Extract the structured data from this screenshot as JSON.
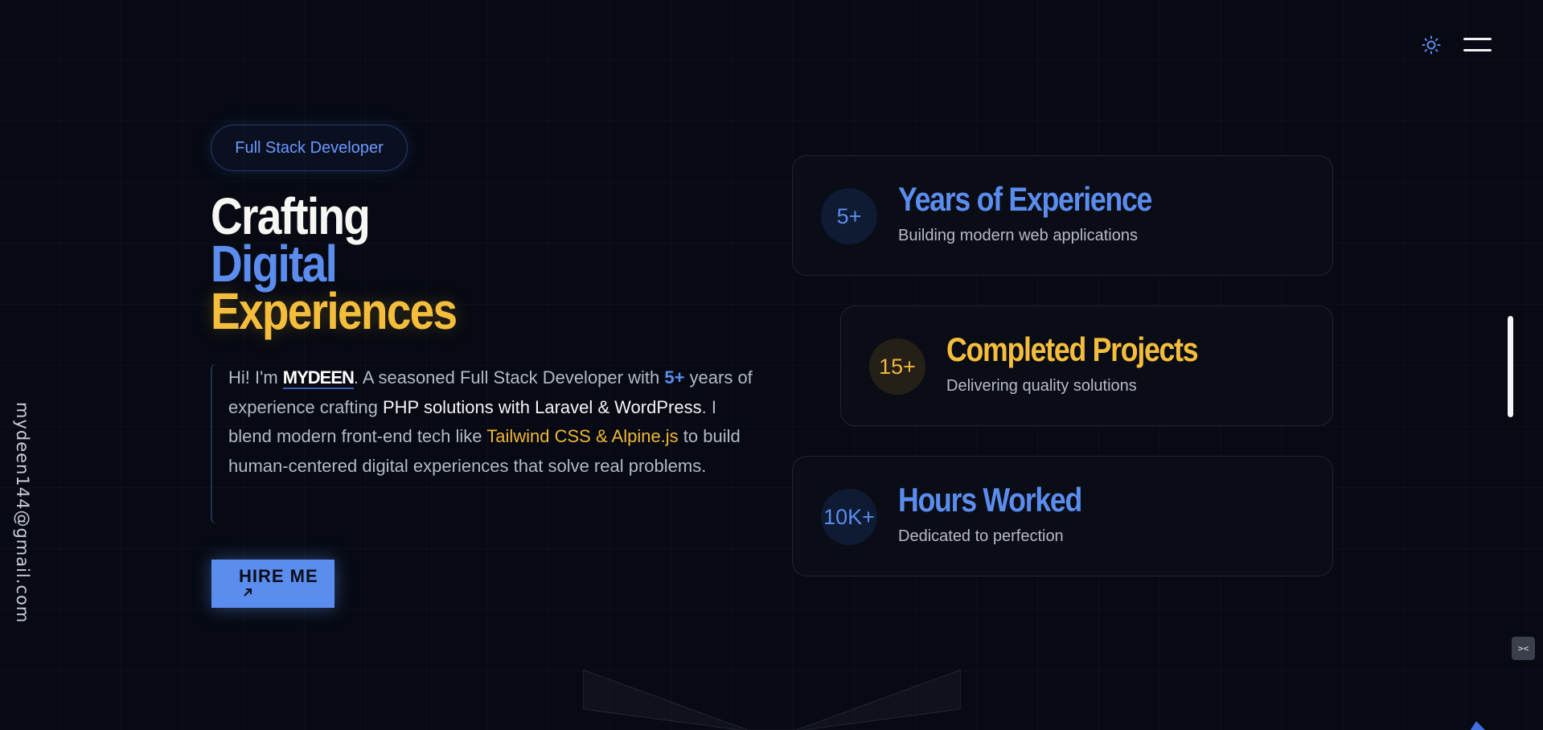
{
  "header": {
    "theme_icon": "sun-icon",
    "menu_icon": "hamburger-menu-icon"
  },
  "sidebar": {
    "email": "mydeen144@gmail.com"
  },
  "hero": {
    "role_badge": "Full Stack Developer",
    "title_line1": "Crafting",
    "title_line2": "Digital",
    "title_line3": "Experiences",
    "intro": {
      "greeting": "Hi! I'm ",
      "name": "MYDEEN",
      "part1": ". A seasoned Full Stack Developer with ",
      "years": "5+",
      "part2": " years of experience crafting ",
      "stack": "PHP solutions with Laravel & WordPress",
      "part3": ". I blend modern front-end tech like ",
      "frontend": "Tailwind CSS & Alpine.js",
      "part4": " to build human-centered digital experiences that solve real problems."
    },
    "cta_label": "HIRE ME",
    "cta_icon": "arrow-up-right-icon"
  },
  "stats": [
    {
      "value": "5+",
      "title": "Years of Experience",
      "subtitle": "Building modern web applications",
      "color": "#5b8def"
    },
    {
      "value": "15+",
      "title": "Completed Projects",
      "subtitle": "Delivering quality solutions",
      "color": "#f4be3c"
    },
    {
      "value": "10K+",
      "title": "Hours Worked",
      "subtitle": "Dedicated to perfection",
      "color": "#5b8def"
    }
  ],
  "colors": {
    "background": "#070a13",
    "accent_blue": "#5b8def",
    "accent_yellow": "#f4be3c"
  }
}
